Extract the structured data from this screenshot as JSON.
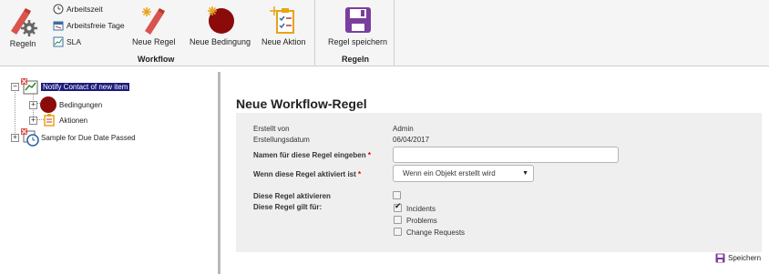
{
  "ribbon": {
    "regeln_btn": "Regeln",
    "arbeitszeit": "Arbeitszeit",
    "arbeitsfreie_tage": "Arbeitsfreie Tage",
    "sla": "SLA",
    "neue_regel": "Neue Regel",
    "neue_bedingung": "Neue Bedingung",
    "neue_aktion": "Neue Aktion",
    "regel_speichern": "Regel speichern",
    "group_workflow": "Workflow",
    "group_regeln": "Regeln"
  },
  "tree": {
    "root1": "Notify Contact of new item",
    "child_bedingungen": "Bedingungen",
    "child_aktionen": "Aktionen",
    "root2": "Sample for Due Date Passed"
  },
  "form": {
    "title": "Neue Workflow-Regel",
    "erstellt_von_label": "Erstellt von",
    "erstellt_von_value": "Admin",
    "datum_label": "Erstellungsdatum",
    "datum_value": "06/04/2017",
    "name_label": "Namen für diese Regel eingeben",
    "name_value": "",
    "aktiviert_label": "Wenn diese Regel aktiviert ist",
    "aktiviert_value": "Wenn ein Objekt erstellt wird",
    "aktivieren_label": "Diese Regel aktivieren",
    "gilt_label": "Diese Regel gilt für:",
    "options": [
      {
        "label": "Incidents",
        "checked": true
      },
      {
        "label": "Problems",
        "checked": false
      },
      {
        "label": "Change Requests",
        "checked": false
      }
    ],
    "required_mark": "*"
  },
  "footer": {
    "save": "Speichern"
  },
  "colors": {
    "selection": "#1b1b7a",
    "bedingung_circle": "#8b0a0a",
    "save_icon": "#7a3e9d"
  }
}
